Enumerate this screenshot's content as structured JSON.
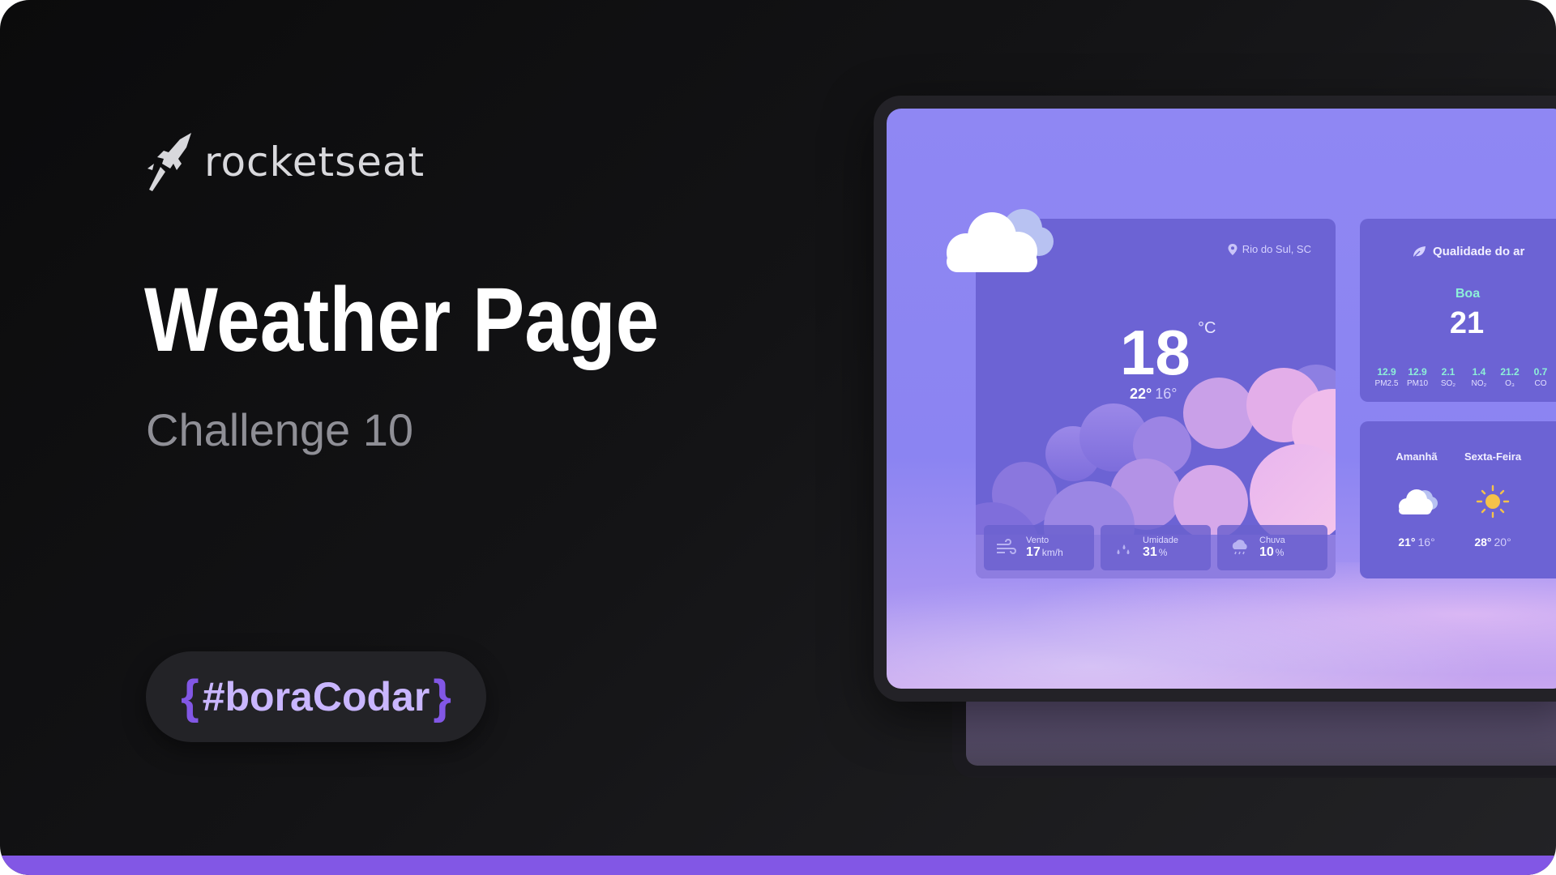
{
  "brand": {
    "logo_text": "rocketseat",
    "logo_icon": "rocket-icon"
  },
  "hero": {
    "title": "Weather Page",
    "subtitle": "Challenge 10"
  },
  "badge": {
    "open_brace": "{",
    "tag": "#boraCodar",
    "close_brace": "}"
  },
  "colors": {
    "accent": "#8257e5",
    "background": "#121214",
    "screen": "#8f87f3",
    "card": "#6c63d4",
    "air_value": "#8df0d8"
  },
  "weather": {
    "location": "Rio do Sul, SC",
    "location_icon": "map-pin-icon",
    "temperature": "18",
    "unit": "°C",
    "max": "22°",
    "min": "16°",
    "stats": [
      {
        "label": "Vento",
        "value": "17",
        "unit": "km/h",
        "icon": "wind-icon"
      },
      {
        "label": "Umidade",
        "value": "31",
        "unit": "%",
        "icon": "drops-icon"
      },
      {
        "label": "Chuva",
        "value": "10",
        "unit": "%",
        "icon": "rain-cloud-icon"
      }
    ]
  },
  "air": {
    "title": "Qualidade do ar",
    "icon": "leaf-icon",
    "quality": "Boa",
    "index": "21",
    "items": [
      {
        "value": "12.9",
        "name": "PM2.5"
      },
      {
        "value": "12.9",
        "name": "PM10"
      },
      {
        "value": "2.1",
        "name": "SO₂"
      },
      {
        "value": "1.4",
        "name": "NO₂"
      },
      {
        "value": "21.2",
        "name": "O₃"
      },
      {
        "value": "0.7",
        "name": "CO"
      }
    ]
  },
  "forecast": [
    {
      "day": "Amanhã",
      "max": "21°",
      "min": "16°",
      "icon": "cloud-icon"
    },
    {
      "day": "Sexta-Feira",
      "max": "28°",
      "min": "20°",
      "icon": "sun-icon"
    }
  ]
}
